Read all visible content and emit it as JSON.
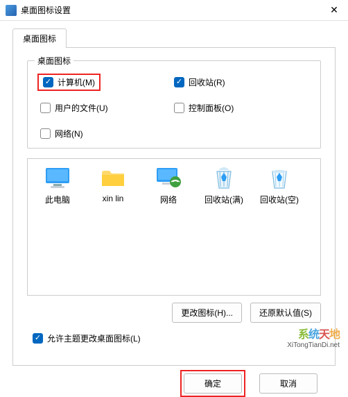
{
  "window": {
    "title": "桌面图标设置",
    "close_glyph": "✕"
  },
  "tab": {
    "label": "桌面图标"
  },
  "group": {
    "legend": "桌面图标",
    "items": {
      "computer": {
        "label": "计算机(M)",
        "checked": true
      },
      "recycle": {
        "label": "回收站(R)",
        "checked": true
      },
      "userfiles": {
        "label": "用户的文件(U)",
        "checked": false
      },
      "control": {
        "label": "控制面板(O)",
        "checked": false
      },
      "network": {
        "label": "网络(N)",
        "checked": false
      }
    }
  },
  "icons": [
    {
      "key": "this-pc",
      "label": "此电脑",
      "icon": "monitor"
    },
    {
      "key": "xinlin",
      "label": "xin lin",
      "icon": "folder"
    },
    {
      "key": "network",
      "label": "网络",
      "icon": "net-monitor"
    },
    {
      "key": "bin-full",
      "label": "回收站(满)",
      "icon": "bin-full"
    },
    {
      "key": "bin-empty",
      "label": "回收站(空)",
      "icon": "bin-empty"
    }
  ],
  "buttons": {
    "change_icon": "更改图标(H)...",
    "restore_default": "还原默认值(S)",
    "ok": "确定",
    "cancel": "取消"
  },
  "allow_theme": {
    "label": "允许主题更改桌面图标(L)",
    "checked": true
  },
  "watermark": {
    "brand": "系统天地",
    "url": "XiTongTianDi.net"
  }
}
